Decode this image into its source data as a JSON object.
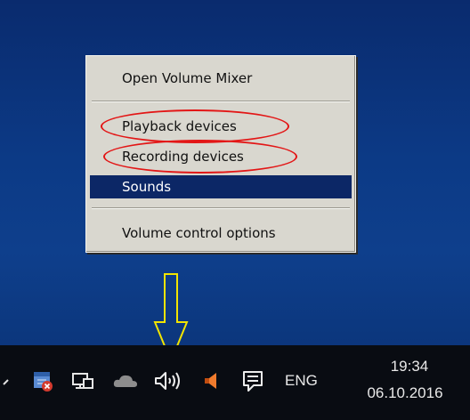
{
  "context_menu": {
    "items": [
      {
        "label": "Open Volume Mixer",
        "selected": false
      },
      {
        "label": "Playback devices",
        "selected": false,
        "highlighted": true
      },
      {
        "label": "Recording devices",
        "selected": false,
        "highlighted": true
      },
      {
        "label": "Sounds",
        "selected": true
      },
      {
        "label": "Volume control options",
        "selected": false
      }
    ],
    "highlight_color": "#e31616",
    "selection_color": "#0c2766"
  },
  "annotation": {
    "arrow_color": "#f2e400",
    "points_to": "volume-icon"
  },
  "taskbar": {
    "tray_icons": [
      "chevron-up-icon",
      "calendar-error-icon",
      "network-icon",
      "onedrive-cloud-icon",
      "volume-icon",
      "speaker-color-icon",
      "action-center-icon"
    ],
    "language": "ENG",
    "clock": {
      "time": "19:34",
      "date": "06.10.2016"
    }
  }
}
